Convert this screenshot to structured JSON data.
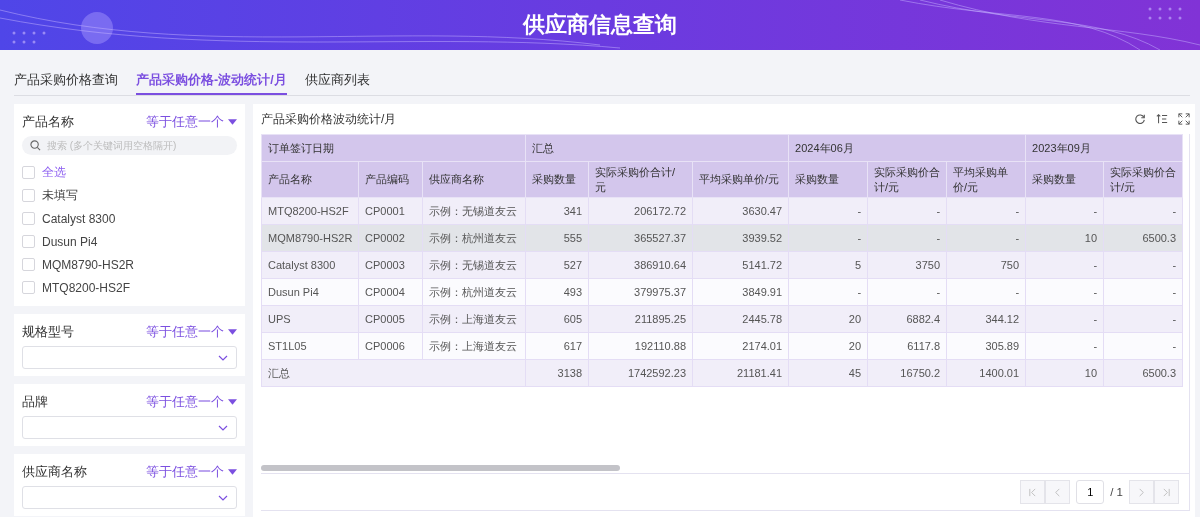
{
  "header": {
    "title": "供应商信息查询"
  },
  "tabs": [
    {
      "label": "产品采购价格查询",
      "selected": false
    },
    {
      "label": "产品采购价格-波动统计/月",
      "selected": true
    },
    {
      "label": "供应商列表",
      "selected": false
    }
  ],
  "filters": [
    {
      "kind": "checklist",
      "label": "产品名称",
      "operator": "等于任意一个",
      "search_placeholder": "搜索 (多个关键词用空格隔开)",
      "options": [
        {
          "kind": "select_all",
          "label": "全选",
          "checked": false
        },
        {
          "kind": "option",
          "label": "未填写",
          "checked": false
        },
        {
          "kind": "option",
          "label": "Catalyst 8300",
          "checked": false
        },
        {
          "kind": "option",
          "label": "Dusun Pi4",
          "checked": false
        },
        {
          "kind": "option",
          "label": "MQM8790-HS2R",
          "checked": false
        },
        {
          "kind": "option",
          "label": "MTQ8200-HS2F",
          "checked": false
        }
      ]
    },
    {
      "kind": "select",
      "label": "规格型号",
      "operator": "等于任意一个"
    },
    {
      "kind": "select",
      "label": "品牌",
      "operator": "等于任意一个"
    },
    {
      "kind": "select",
      "label": "供应商名称",
      "operator": "等于任意一个"
    }
  ],
  "report": {
    "title": "产品采购价格波动统计/月",
    "table": {
      "groups": [
        {
          "label": "订单签订日期",
          "columns": [
            "产品名称",
            "产品编码",
            "供应商名称"
          ]
        },
        {
          "label": "汇总",
          "columns": [
            "采购数量",
            "实际采购价合计/元",
            "平均采购单价/元"
          ]
        },
        {
          "label": "2024年06月",
          "columns": [
            "采购数量",
            "实际采购价合计/元",
            "平均采购单价/元"
          ]
        },
        {
          "label": "2023年09月",
          "columns": [
            "采购数量",
            "实际采购价合计/元"
          ]
        }
      ],
      "rows": [
        {
          "highlighted": false,
          "cells": [
            "MTQ8200-HS2F",
            "CP0001",
            "示例：无锡道友云",
            "341",
            "206172.72",
            "3630.47",
            "-",
            "-",
            "-",
            "-",
            "-"
          ]
        },
        {
          "highlighted": true,
          "cells": [
            "MQM8790-HS2R",
            "CP0002",
            "示例：杭州道友云",
            "555",
            "365527.37",
            "3939.52",
            "-",
            "-",
            "-",
            "10",
            "6500.3"
          ]
        },
        {
          "highlighted": false,
          "cells": [
            "Catalyst 8300",
            "CP0003",
            "示例：无锡道友云",
            "527",
            "386910.64",
            "5141.72",
            "5",
            "3750",
            "750",
            "-",
            "-"
          ]
        },
        {
          "highlighted": false,
          "cells": [
            "Dusun Pi4",
            "CP0004",
            "示例：杭州道友云",
            "493",
            "379975.37",
            "3849.91",
            "-",
            "-",
            "-",
            "-",
            "-"
          ]
        },
        {
          "highlighted": false,
          "cells": [
            "UPS",
            "CP0005",
            "示例：上海道友云",
            "605",
            "211895.25",
            "2445.78",
            "20",
            "6882.4",
            "344.12",
            "-",
            "-"
          ]
        },
        {
          "highlighted": false,
          "cells": [
            "ST1L05",
            "CP0006",
            "示例：上海道友云",
            "617",
            "192110.88",
            "2174.01",
            "20",
            "6117.8",
            "305.89",
            "-",
            "-"
          ]
        }
      ],
      "summary": {
        "label": "汇总",
        "values": [
          "3138",
          "1742592.23",
          "21181.41",
          "45",
          "16750.2",
          "1400.01",
          "10",
          "6500.3"
        ]
      }
    },
    "pagination": {
      "first_disabled": true,
      "prev_disabled": true,
      "page": "1",
      "total": "/ 1",
      "next_disabled": true,
      "last_disabled": true
    }
  }
}
